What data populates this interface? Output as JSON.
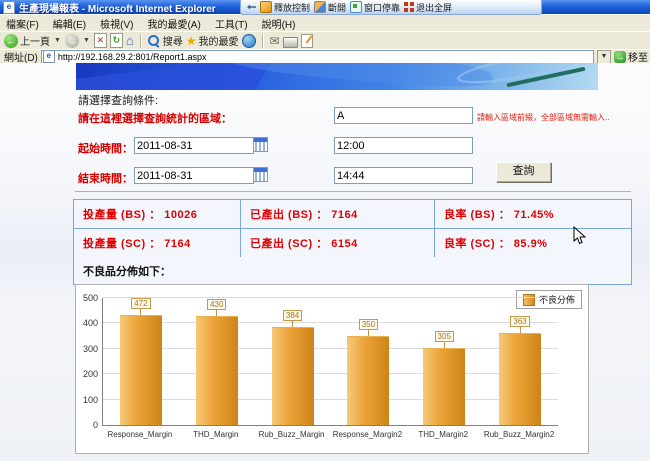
{
  "window": {
    "title": "生產現場報表 - Microsoft Internet Explorer",
    "remote_toolbar": {
      "release_control": "釋放控制",
      "disconnect": "斷開",
      "dock": "窗口停靠",
      "exit_fullscreen": "退出全屏"
    }
  },
  "menu_bar": [
    "檔案(F)",
    "編輯(E)",
    "檢視(V)",
    "我的最愛(A)",
    "工具(T)",
    "說明(H)"
  ],
  "toolbar": {
    "back_label": "上一頁",
    "search_label": "搜尋",
    "favorites_label": "我的最愛"
  },
  "address_bar": {
    "label": "網址(D)",
    "url": "http://192.168.29.2:801/Report1.aspx",
    "go_label": "移至"
  },
  "form": {
    "prompt": "請選擇查詢條件:",
    "region_label": "請在這裡選擇查詢統計的區域：",
    "region_value": "A",
    "region_hint": "請輸入區域前綴，全部區域無需輸入..",
    "start_label": "起始時間：",
    "start_date": "2011-08-31",
    "start_time": "12:00",
    "end_label": "結束時間：",
    "end_date": "2011-08-31",
    "end_time": "14:44",
    "query_button": "查詢"
  },
  "stats": {
    "rows": [
      [
        "投產量 (BS) ：  10026",
        "已產出 (BS) ： 7164",
        "良率 (BS) ：  71.45%"
      ],
      [
        "投產量 (SC) ：  7164",
        "已產出 (SC) ： 6154",
        "良率 (SC) ：  85.9%"
      ]
    ],
    "defect_header": "不良品分佈如下："
  },
  "chart_data": {
    "type": "bar",
    "title": "",
    "categories": [
      "Response_Margin",
      "THD_Margin",
      "Rub_Buzz_Margin",
      "Response_Margin2",
      "THD_Margin2",
      "Rub_Buzz_Margin2"
    ],
    "series": [
      {
        "name": "不良分佈",
        "values": [
          472,
          430,
          384,
          350,
          305,
          363
        ]
      }
    ],
    "ylim": [
      0,
      500
    ],
    "yticks": [
      0,
      100,
      200,
      300,
      400,
      500
    ],
    "grid": true,
    "legend_position": "top-right",
    "bar_color": "#e0952a",
    "label_box_color": "#a8761d"
  }
}
